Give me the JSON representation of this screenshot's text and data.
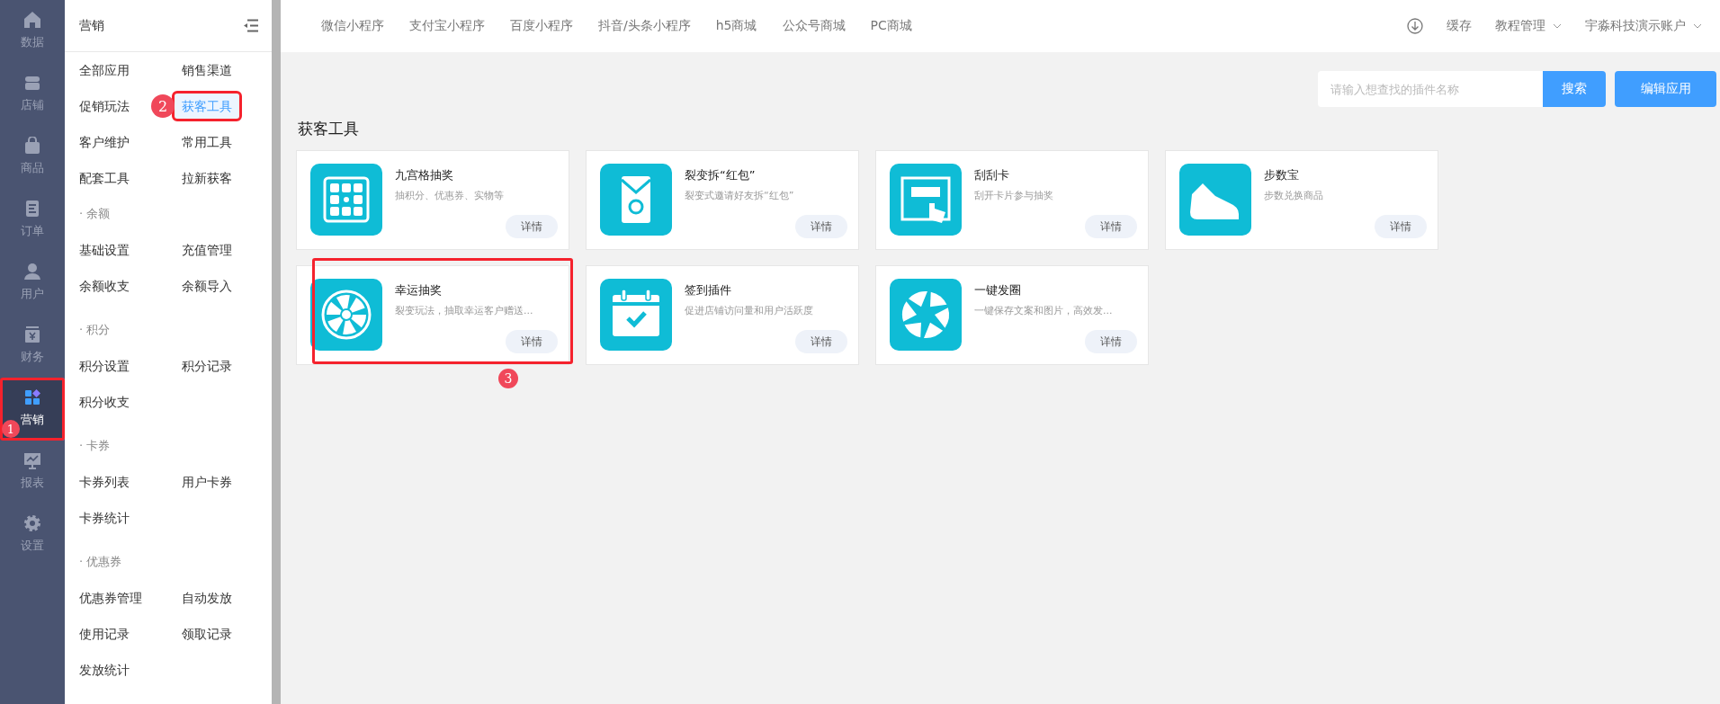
{
  "rail": [
    {
      "label": "数据",
      "selected": false
    },
    {
      "label": "店铺",
      "selected": false
    },
    {
      "label": "商品",
      "selected": false
    },
    {
      "label": "订单",
      "selected": false
    },
    {
      "label": "用户",
      "selected": false
    },
    {
      "label": "财务",
      "selected": false
    },
    {
      "label": "营销",
      "selected": true,
      "annotation": "1"
    },
    {
      "label": "报表",
      "selected": false
    },
    {
      "label": "设置",
      "selected": false
    }
  ],
  "submenu": {
    "title": "营销",
    "groups": [
      {
        "items": [
          {
            "label": "全部应用",
            "selected": false
          },
          {
            "label": "销售渠道",
            "selected": false
          },
          {
            "label": "促销玩法",
            "selected": false
          },
          {
            "label": "获客工具",
            "selected": true,
            "annotation": "2"
          },
          {
            "label": "客户维护",
            "selected": false
          },
          {
            "label": "常用工具",
            "selected": false
          },
          {
            "label": "配套工具",
            "selected": false
          },
          {
            "label": "拉新获客",
            "selected": false
          }
        ]
      },
      {
        "heading": "· 余额",
        "items": [
          {
            "label": "基础设置",
            "selected": false
          },
          {
            "label": "充值管理",
            "selected": false
          },
          {
            "label": "余额收支",
            "selected": false
          },
          {
            "label": "余额导入",
            "selected": false
          }
        ]
      },
      {
        "heading": "· 积分",
        "items": [
          {
            "label": "积分设置",
            "selected": false
          },
          {
            "label": "积分记录",
            "selected": false
          },
          {
            "label": "积分收支",
            "selected": false
          }
        ]
      },
      {
        "heading": "· 卡券",
        "items": [
          {
            "label": "卡券列表",
            "selected": false
          },
          {
            "label": "用户卡券",
            "selected": false
          },
          {
            "label": "卡券统计",
            "selected": false
          }
        ]
      },
      {
        "heading": "· 优惠券",
        "items": [
          {
            "label": "优惠券管理",
            "selected": false
          },
          {
            "label": "自动发放",
            "selected": false
          },
          {
            "label": "使用记录",
            "selected": false
          },
          {
            "label": "领取记录",
            "selected": false
          },
          {
            "label": "发放统计",
            "selected": false
          }
        ]
      }
    ]
  },
  "top_nav": [
    "微信小程序",
    "支付宝小程序",
    "百度小程序",
    "抖音/头条小程序",
    "h5商城",
    "公众号商城",
    "PC商城"
  ],
  "top_right": {
    "cache": "缓存",
    "tutorial": "教程管理",
    "account": "宇淼科技演示账户"
  },
  "search": {
    "placeholder": "请输入想查找的插件名称",
    "button": "搜索"
  },
  "edit_button": "编辑应用",
  "section_title": "获客工具",
  "cards": [
    {
      "title": "九宫格抽奖",
      "desc": "抽积分、优惠券、实物等",
      "button": "详情"
    },
    {
      "title": "裂变拆“红包”",
      "desc": "裂变式邀请好友拆“红包”",
      "button": "详情"
    },
    {
      "title": "刮刮卡",
      "desc": "刮开卡片参与抽奖",
      "button": "详情"
    },
    {
      "title": "步数宝",
      "desc": "步数兑换商品",
      "button": "详情"
    },
    {
      "title": "幸运抽奖",
      "desc": "裂变玩法，抽取幸运客户赠送...",
      "button": "详情",
      "annotation": "3"
    },
    {
      "title": "签到插件",
      "desc": "促进店铺访问量和用户活跃度",
      "button": "详情"
    },
    {
      "title": "一键发圈",
      "desc": "一键保存文案和图片，高效发...",
      "button": "详情"
    }
  ]
}
